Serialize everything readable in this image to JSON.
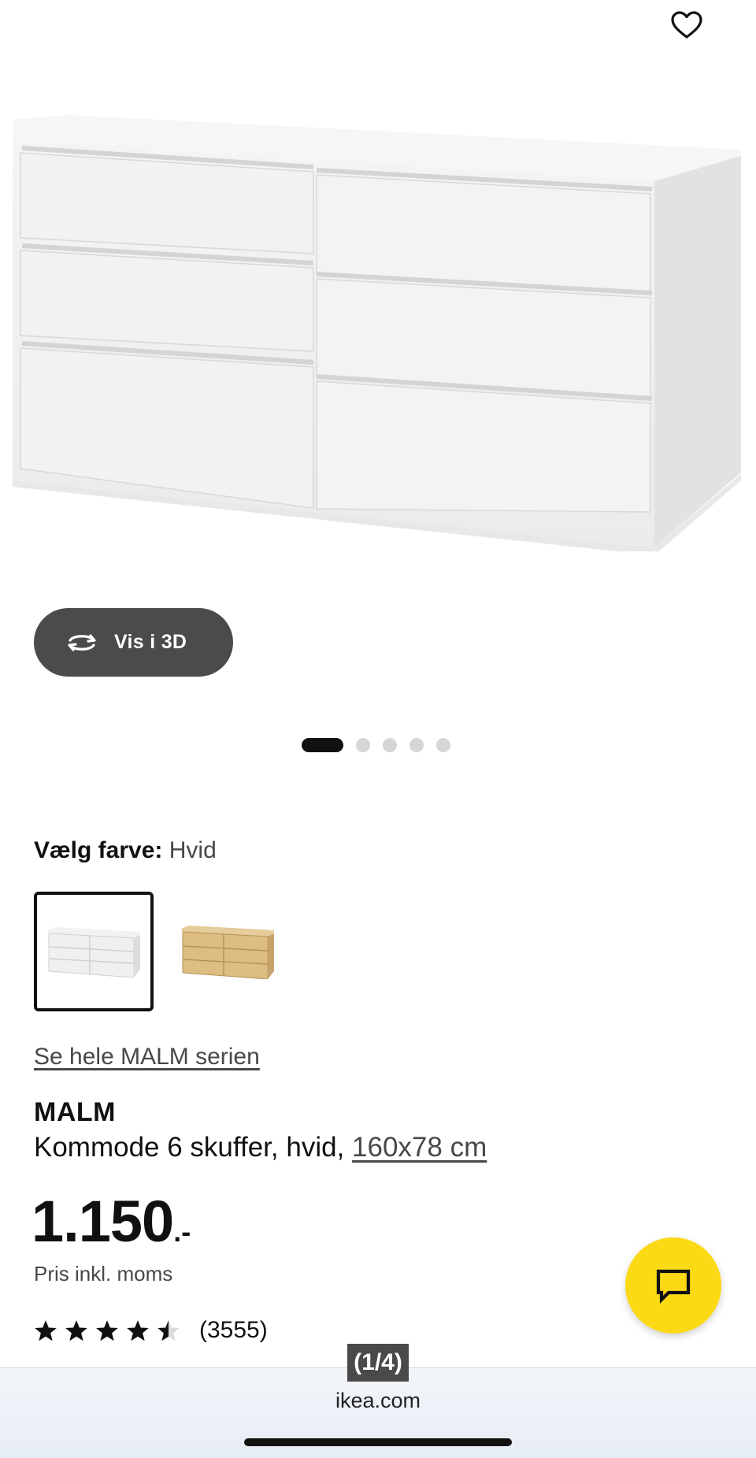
{
  "product_gallery": {
    "view3d_label": "Vis i 3D",
    "dots_total": 5,
    "dots_active": 1
  },
  "color_picker": {
    "label": "Vælg farve:",
    "selected_value": "Hvid",
    "swatches": [
      "white",
      "oak"
    ]
  },
  "series_link": "Se hele MALM serien",
  "product": {
    "name": "MALM",
    "description": "Kommode 6 skuffer, hvid, ",
    "size_link": "160x78 cm",
    "price_main": "1.150",
    "price_suffix": ".-",
    "price_note": "Pris inkl. moms",
    "rating_value": 4.5,
    "rating_max": 5,
    "review_count": "(3555)"
  },
  "image_counter": "(1/4)",
  "browser": {
    "url": "ikea.com"
  },
  "colors": {
    "chat_button": "#fbd914",
    "view3d_bg": "#4b4b4b"
  },
  "icons": [
    "heart-icon",
    "rotate-3d-icon",
    "chat-icon",
    "star-icon"
  ]
}
